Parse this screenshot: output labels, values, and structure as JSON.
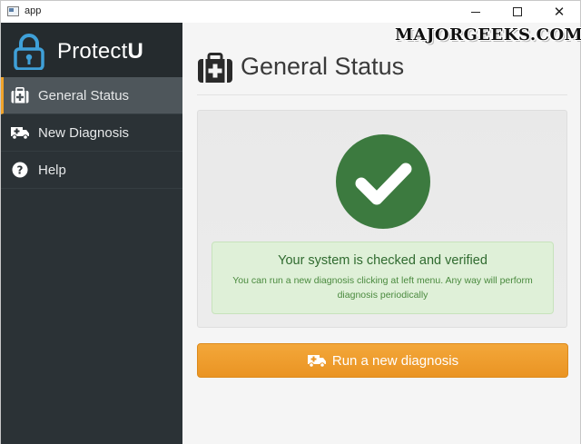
{
  "window": {
    "title": "app"
  },
  "watermark": "MAJORGEEKS.COM",
  "brand": {
    "name_regular": "Protect",
    "name_bold": "U"
  },
  "sidebar": {
    "items": [
      {
        "label": "General Status",
        "icon": "medkit-icon",
        "active": true
      },
      {
        "label": "New Diagnosis",
        "icon": "ambulance-icon",
        "active": false
      },
      {
        "label": "Help",
        "icon": "question-circle-icon",
        "active": false
      }
    ]
  },
  "main": {
    "title": "General Status",
    "status": {
      "title": "Your system is checked and verified",
      "description": "You can run a new diagnosis clicking at left menu. Any way will perform diagnosis periodically"
    },
    "run_button": "Run a new diagnosis"
  },
  "colors": {
    "sidebar_bg": "#2b3236",
    "active_accent": "#f0a32b",
    "logo_blue": "#3fa0d8",
    "check_green": "#3c7a3f",
    "success_bg": "#dff0d8",
    "button_orange": "#f0a030"
  }
}
